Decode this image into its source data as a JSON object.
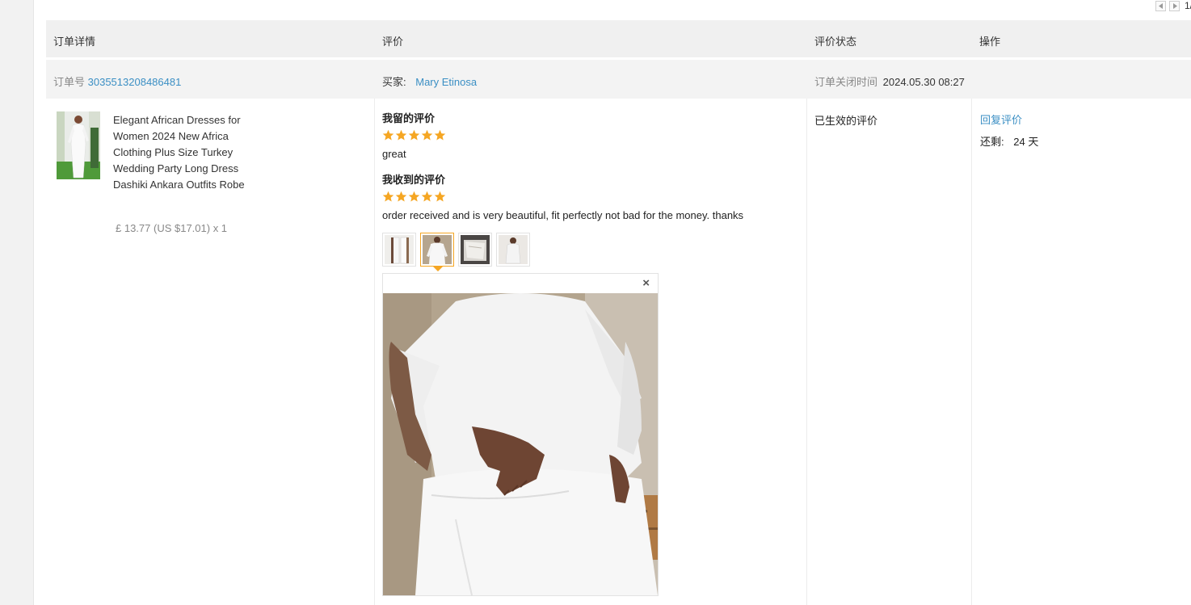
{
  "pager": {
    "text": "1/"
  },
  "header": {
    "col_order": "订单详情",
    "col_review": "评价",
    "col_status": "评价状态",
    "col_action": "操作"
  },
  "order": {
    "number_label": "订单号",
    "number": "3035513208486481",
    "buyer_label": "买家:",
    "buyer_name": "Mary Etinosa",
    "closed_label": "订单关闭时间",
    "closed_time": "2024.05.30 08:27"
  },
  "product": {
    "title": "Elegant African Dresses for Women 2024 New Africa Clothing Plus Size Turkey Wedding Party Long Dress Dashiki Ankara Outfits Robe",
    "price": "£ 13.77 (US $17.01) x 1"
  },
  "my_review": {
    "heading": "我留的评价",
    "rating": 5,
    "text": "great"
  },
  "received_review": {
    "heading": "我收到的评价",
    "rating": 5,
    "text": "order received and is very beautiful, fit perfectly not bad for the money. thanks",
    "photo_count": 4,
    "selected_photo_index": 1
  },
  "viewer": {
    "close_symbol": "×"
  },
  "status": {
    "text": "已生效的评价"
  },
  "action": {
    "reply_label": "回复评价",
    "remaining_label": "还剩:",
    "remaining_value": "24 天"
  },
  "colors": {
    "link": "#3b8fc4",
    "star": "#f5a623",
    "header_bg": "#f0f0f0"
  }
}
